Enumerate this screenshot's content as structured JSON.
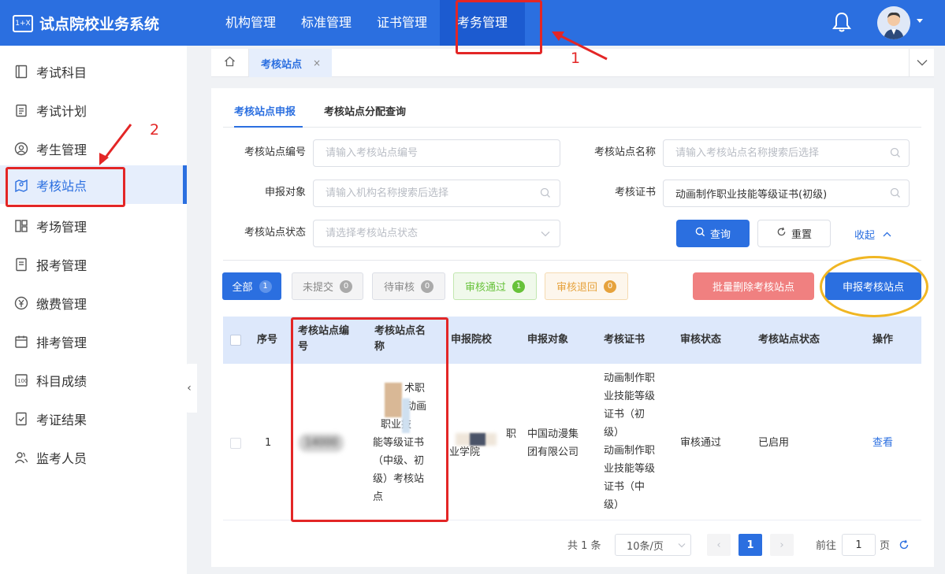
{
  "app": {
    "title": "试点院校业务系统",
    "logo_text": "1+X"
  },
  "topnav": [
    {
      "label": "机构管理"
    },
    {
      "label": "标准管理"
    },
    {
      "label": "证书管理"
    },
    {
      "label": "考务管理"
    }
  ],
  "sidebar": [
    {
      "label": "考试科目",
      "icon": "book-icon"
    },
    {
      "label": "考试计划",
      "icon": "clipboard-icon"
    },
    {
      "label": "考生管理",
      "icon": "user-circle-icon"
    },
    {
      "label": "考核站点",
      "icon": "map-pin-icon"
    },
    {
      "label": "考场管理",
      "icon": "grid-icon"
    },
    {
      "label": "报考管理",
      "icon": "document-icon"
    },
    {
      "label": "缴费管理",
      "icon": "yen-icon"
    },
    {
      "label": "排考管理",
      "icon": "calendar-icon"
    },
    {
      "label": "科目成绩",
      "icon": "score-icon"
    },
    {
      "label": "考证结果",
      "icon": "check-doc-icon"
    },
    {
      "label": "监考人员",
      "icon": "users-icon"
    }
  ],
  "tabs": {
    "current": "考核站点",
    "close": "×"
  },
  "subtabs": [
    {
      "label": "考核站点申报"
    },
    {
      "label": "考核站点分配查询"
    }
  ],
  "form": {
    "site_code_label": "考核站点编号",
    "site_code_placeholder": "请输入考核站点编号",
    "site_name_label": "考核站点名称",
    "site_name_placeholder": "请输入考核站点名称搜索后选择",
    "target_label": "申报对象",
    "target_placeholder": "请输入机构名称搜索后选择",
    "cert_label": "考核证书",
    "cert_value": "动画制作职业技能等级证书(初级)",
    "status_label": "考核站点状态",
    "status_placeholder": "请选择考核站点状态",
    "search_label": "查询",
    "reset_label": "重置",
    "collapse_label": "收起"
  },
  "filters": [
    {
      "label": "全部",
      "count": "1"
    },
    {
      "label": "未提交",
      "count": "0"
    },
    {
      "label": "待审核",
      "count": "0"
    },
    {
      "label": "审核通过",
      "count": "1"
    },
    {
      "label": "审核退回",
      "count": "0"
    }
  ],
  "actions": {
    "batch_delete": "批量删除考核站点",
    "declare": "申报考核站点"
  },
  "table": {
    "headers": {
      "index": "序号",
      "code_l1": "考核站点编",
      "code_l2": "号",
      "name_l1": "考核站点名",
      "name_l2": "称",
      "school": "申报院校",
      "target": "申报对象",
      "cert": "考核证书",
      "audit": "审核状态",
      "status": "考核站点状态",
      "op": "操作"
    },
    "row": {
      "index": "1",
      "code": "14000",
      "name_lines": [
        "术职",
        "动画",
        "职业技",
        "能等级证书",
        "（中级、初",
        "级）考核站",
        "点"
      ],
      "school_lines": [
        "职",
        "业学院"
      ],
      "target_lines": [
        "中国动漫集",
        "团有限公司"
      ],
      "cert_lines": [
        "动画制作职",
        "业技能等级",
        "证书（初",
        "级）",
        "动画制作职",
        "业技能等级",
        "证书（中",
        "级）"
      ],
      "audit": "审核通过",
      "status": "已启用",
      "op": "查看"
    }
  },
  "pager": {
    "total": "共 1 条",
    "size": "10条/页",
    "page": "1",
    "goto_prefix": "前往",
    "goto_value": "1",
    "goto_suffix": "页"
  },
  "annotations": {
    "step1": "1",
    "step2": "2"
  },
  "colors": {
    "primary": "#2b6fe0",
    "annotation_red": "#e32626",
    "annotation_yellow": "#f0b623"
  }
}
